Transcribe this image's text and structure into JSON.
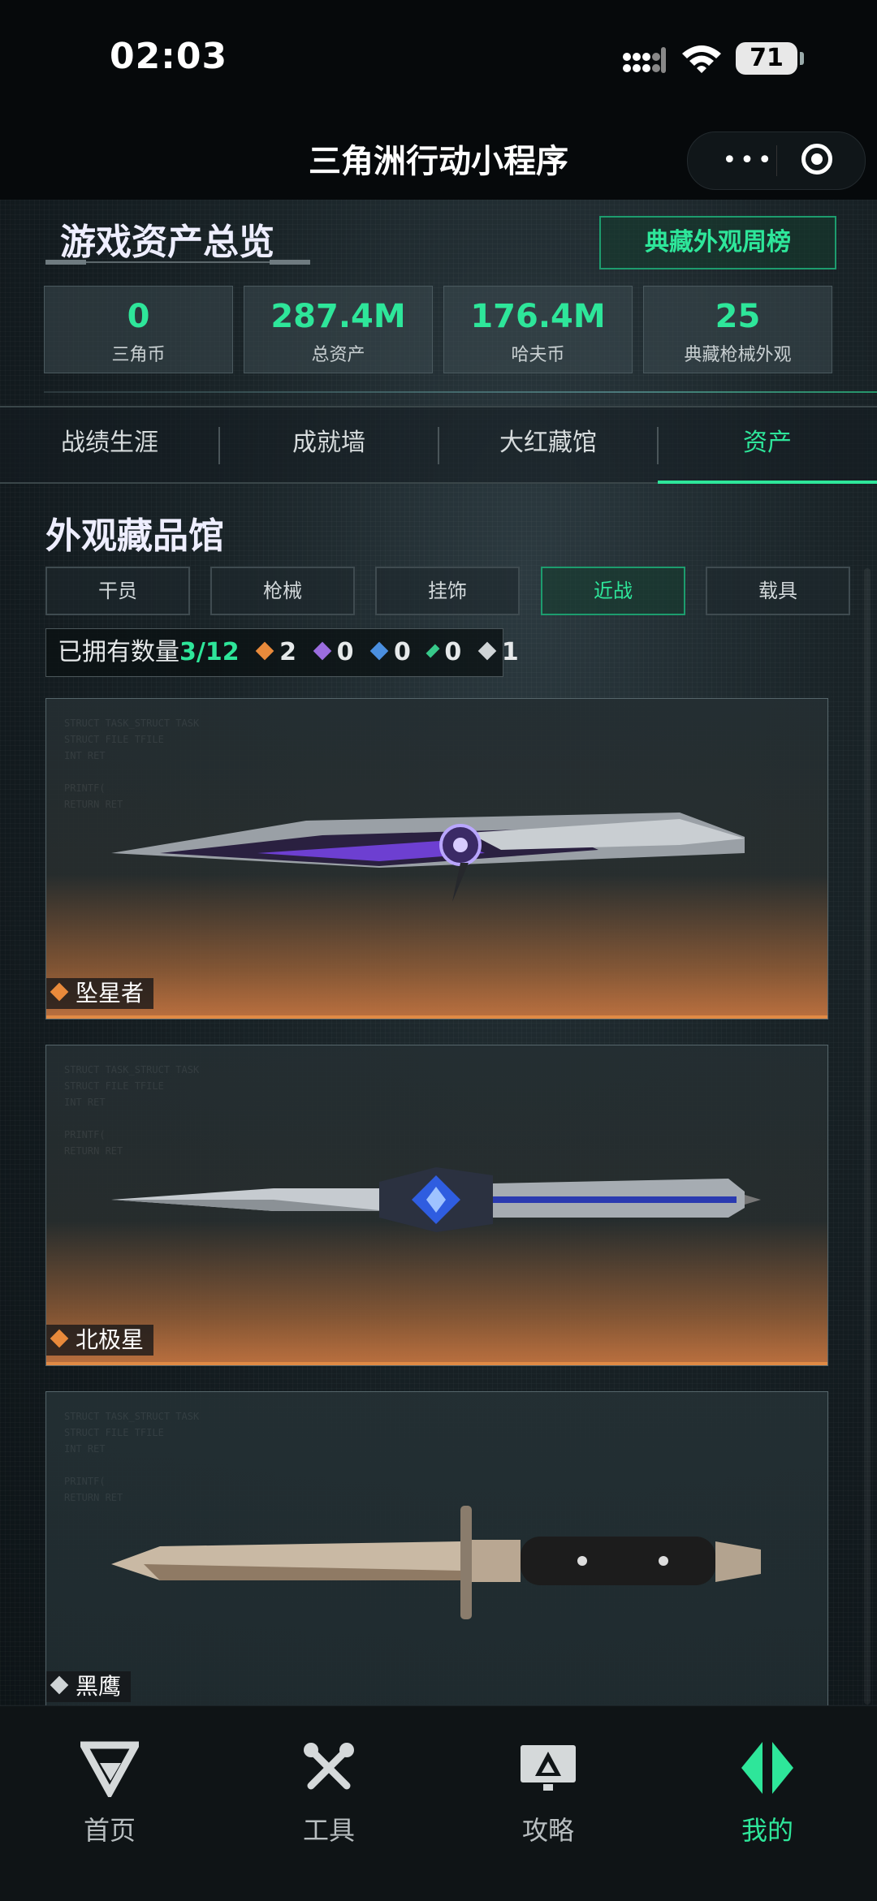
{
  "status_bar": {
    "time": "02:03",
    "battery": "71"
  },
  "nav": {
    "title": "三角洲行动小程序",
    "more": "•••"
  },
  "overview": {
    "title": "游戏资产总览",
    "rank_button": "典藏外观周榜",
    "stats": [
      {
        "value": "0",
        "label": "三角币"
      },
      {
        "value": "287.4M",
        "label": "总资产"
      },
      {
        "value": "176.4M",
        "label": "哈夫币"
      },
      {
        "value": "25",
        "label": "典藏枪械外观"
      }
    ]
  },
  "tabs": [
    {
      "label": "战绩生涯"
    },
    {
      "label": "成就墙"
    },
    {
      "label": "大红藏馆"
    },
    {
      "label": "资产",
      "active": true
    }
  ],
  "gallery": {
    "title": "外观藏品馆",
    "categories": [
      {
        "label": "干员"
      },
      {
        "label": "枪械"
      },
      {
        "label": "挂饰"
      },
      {
        "label": "近战",
        "active": true
      },
      {
        "label": "载具"
      }
    ],
    "owned_label": "已拥有数量",
    "owned_count": "3/12",
    "rarity_counts": [
      {
        "color": "#e98a3b",
        "count": "2"
      },
      {
        "color": "#9b6ddf",
        "count": "0"
      },
      {
        "color": "#4a8fe0",
        "count": "0"
      },
      {
        "color": "#37c98a",
        "count": "0"
      },
      {
        "color": "#cfd4d6",
        "count": "1"
      }
    ],
    "items": [
      {
        "name": "坠星者",
        "rarity_color": "#e98a3b"
      },
      {
        "name": "北极星",
        "rarity_color": "#e98a3b"
      },
      {
        "name": "黑鹰",
        "rarity_color": "#cfd4d6"
      }
    ]
  },
  "tabbar": [
    {
      "label": "首页",
      "icon": "delta-logo-icon"
    },
    {
      "label": "工具",
      "icon": "tools-icon"
    },
    {
      "label": "攻略",
      "icon": "guide-icon"
    },
    {
      "label": "我的",
      "icon": "profile-icon",
      "active": true
    }
  ],
  "colors": {
    "accent": "#2ee69a",
    "gold": "#e98a3b"
  }
}
